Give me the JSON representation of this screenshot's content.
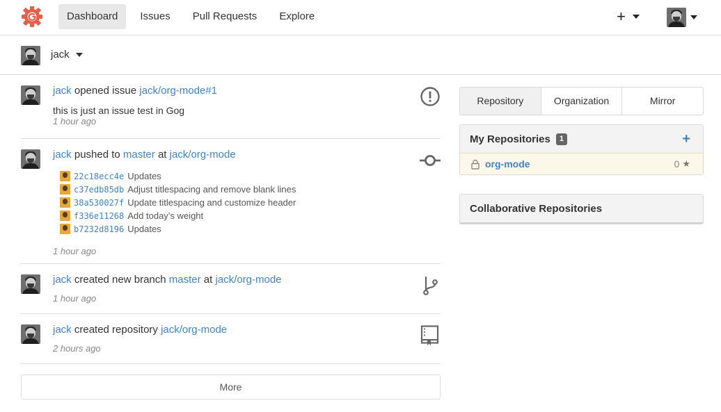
{
  "nav": {
    "items": [
      "Dashboard",
      "Issues",
      "Pull Requests",
      "Explore"
    ],
    "active": "Dashboard",
    "plus_label": "+"
  },
  "context": {
    "user": "jack"
  },
  "feed": [
    {
      "actor": "jack",
      "action": "opened issue",
      "target": "jack/org-mode#1",
      "body": "this is just an issue test in Gog",
      "time": "1 hour ago",
      "icon": "issue-opened-icon"
    },
    {
      "actor": "jack",
      "action": "pushed to",
      "ref": "master",
      "at": "at",
      "target": "jack/org-mode",
      "commits": [
        {
          "sha": "22c18ecc4e",
          "message": "Updates"
        },
        {
          "sha": "c37edb85db",
          "message": "Adjust titlespacing and remove blank lines"
        },
        {
          "sha": "38a530027f",
          "message": "Update titlespacing and customize header"
        },
        {
          "sha": "f336e11268",
          "message": "Add today’s weight"
        },
        {
          "sha": "b7232d8196",
          "message": "Updates"
        }
      ],
      "time": "1 hour ago",
      "icon": "git-commit-icon"
    },
    {
      "actor": "jack",
      "action": "created new branch",
      "ref": "master",
      "at": "at",
      "target": "jack/org-mode",
      "time": "1 hour ago",
      "icon": "git-branch-icon"
    },
    {
      "actor": "jack",
      "action": "created repository",
      "target": "jack/org-mode",
      "time": "2 hours ago",
      "icon": "repo-book-icon"
    }
  ],
  "more_label": "More",
  "tabs": [
    "Repository",
    "Organization",
    "Mirror"
  ],
  "active_tab": "Repository",
  "my_repos": {
    "title": "My Repositories",
    "count": "1",
    "add_label": "+",
    "repos": [
      {
        "name": "org-mode",
        "stars": "0",
        "private": true
      }
    ]
  },
  "collab": {
    "title": "Collaborative Repositories"
  },
  "colors": {
    "link": "#4183c4",
    "logo": "#e65f4a",
    "repo_row_bg": "#fbf8e9"
  }
}
